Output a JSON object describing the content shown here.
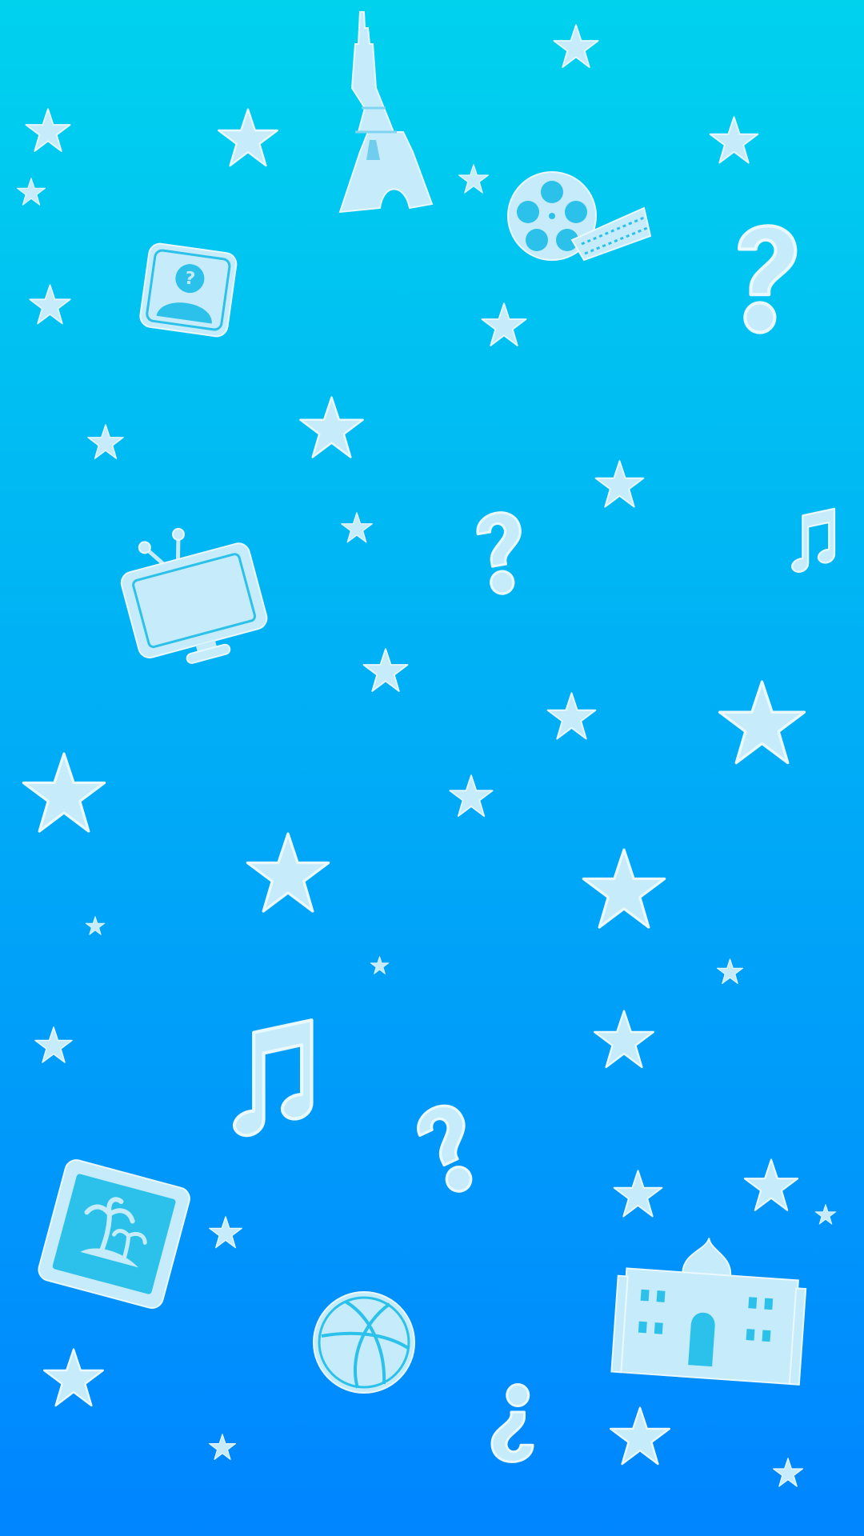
{
  "theme": {
    "gradient_top": "#00d2ee",
    "gradient_bottom": "#0085ff",
    "icon_fill": "#c6ecfb",
    "icon_outline": "#eaf8ff"
  },
  "doodles": [
    {
      "icon": "eiffel-tower-icon"
    },
    {
      "icon": "film-reel-icon"
    },
    {
      "icon": "question-mark-icon"
    },
    {
      "icon": "mystery-person-icon"
    },
    {
      "icon": "tv-icon"
    },
    {
      "icon": "music-note-icon"
    },
    {
      "icon": "photo-palm-trees-icon"
    },
    {
      "icon": "basketball-icon"
    },
    {
      "icon": "taj-mahal-icon"
    },
    {
      "icon": "star-icon"
    }
  ]
}
